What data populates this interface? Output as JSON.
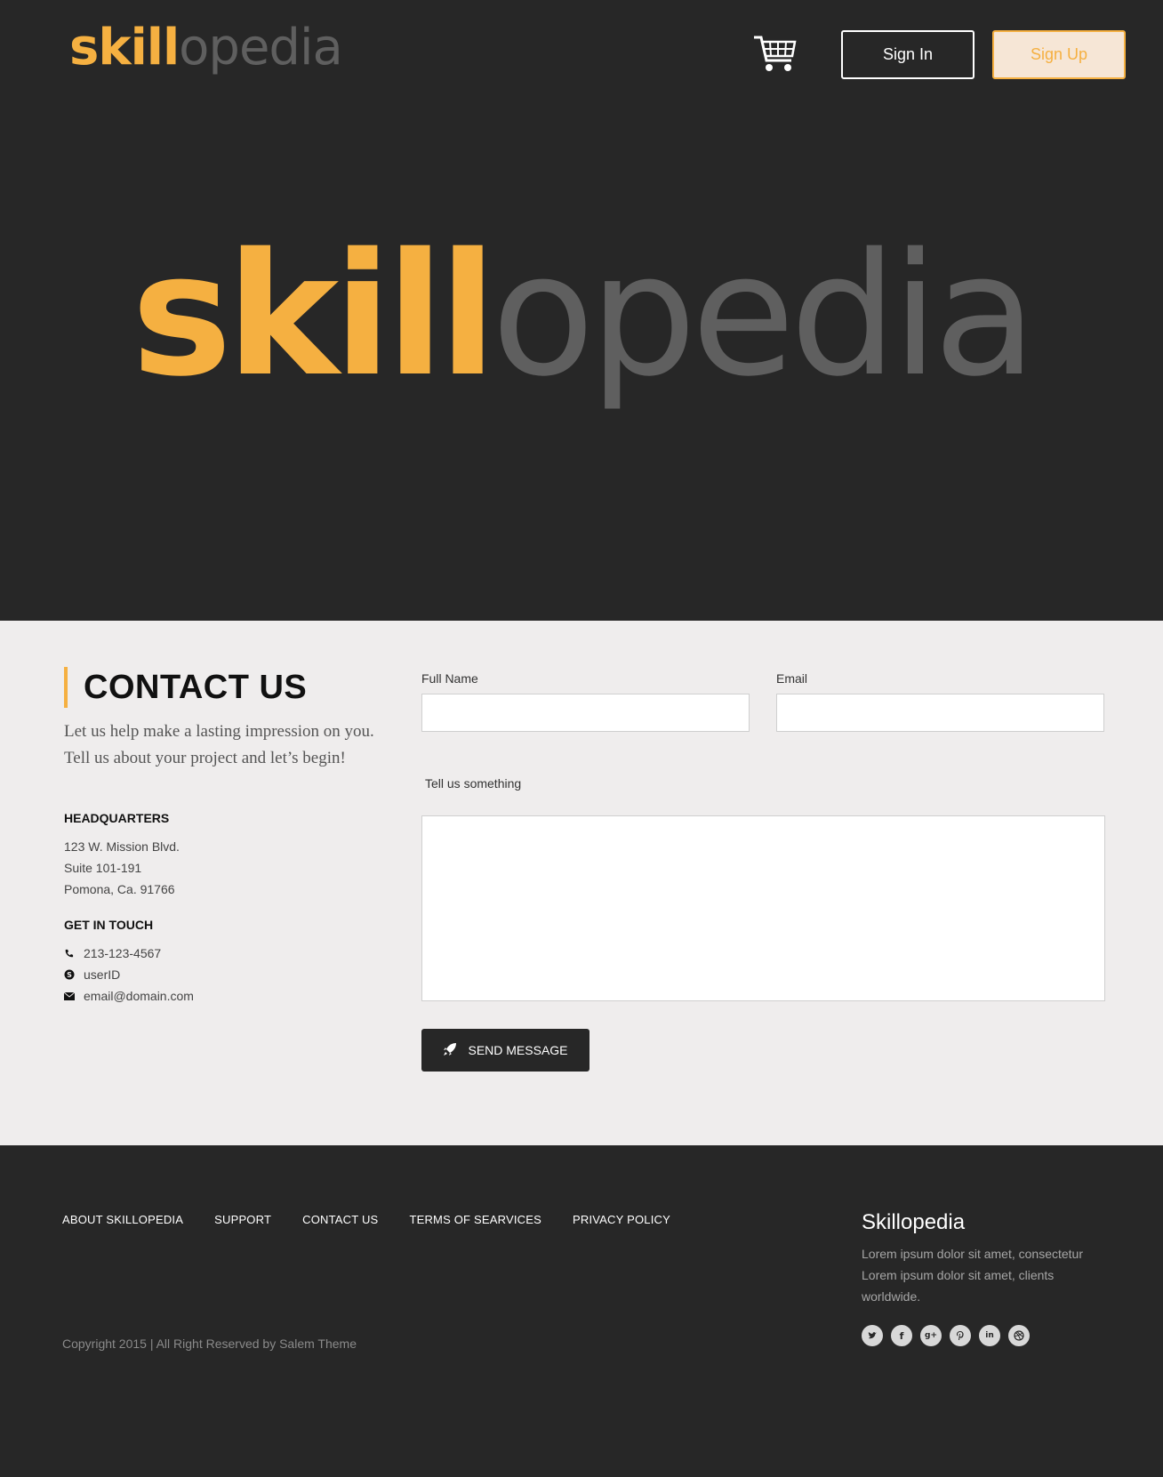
{
  "header": {
    "logo": {
      "part1": "skill",
      "part2": "opedia"
    },
    "cart_icon": "shopping-cart-icon",
    "signin_label": "Sign In",
    "signup_label": "Sign Up"
  },
  "hero": {
    "logo": {
      "part1": "skill",
      "part2": "opedia"
    }
  },
  "contact": {
    "title": "CONTACT US",
    "intro": "Let us help make a lasting impression on you. Tell us about your project and let’s begin!",
    "hq_heading": "HEADQUARTERS",
    "hq_lines": [
      "123 W. Mission Blvd.",
      "Suite 101-191",
      "Pomona, Ca. 91766"
    ],
    "touch_heading": "GET IN TOUCH",
    "touch_items": [
      {
        "icon": "phone-icon",
        "text": "213-123-4567"
      },
      {
        "icon": "skype-icon",
        "text": "userID"
      },
      {
        "icon": "envelope-icon",
        "text": "email@domain.com"
      }
    ],
    "form": {
      "fullname_label": "Full Name",
      "fullname_value": "",
      "email_label": "Email",
      "email_value": "",
      "message_label": "Tell us something",
      "message_value": "",
      "send_label": "SEND MESSAGE"
    }
  },
  "footer": {
    "nav": [
      "ABOUT SKILLOPEDIA",
      "SUPPORT",
      "CONTACT US",
      "TERMS OF SEARVICES",
      "PRIVACY POLICY"
    ],
    "copyright": "Copyright 2015 | All Right Reserved by Salem Theme",
    "brand": "Skillopedia",
    "description": "Lorem ipsum dolor sit amet, consectetur Lorem ipsum dolor sit amet,  clients worldwide.",
    "socials": [
      "twitter-icon",
      "facebook-icon",
      "google-plus-icon",
      "pinterest-icon",
      "linkedin-icon",
      "dribbble-icon"
    ]
  },
  "colors": {
    "accent": "#f5b041",
    "dark_bg": "#272727",
    "light_bg": "#efeded",
    "logo_grey": "#5f5f5f"
  }
}
